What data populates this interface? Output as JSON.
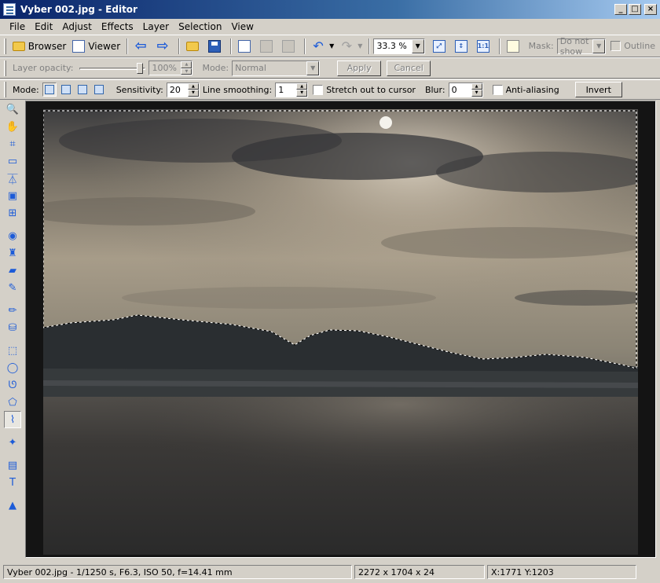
{
  "window": {
    "title": "Vyber 002.jpg - Editor"
  },
  "menu": [
    "File",
    "Edit",
    "Adjust",
    "Effects",
    "Layer",
    "Selection",
    "View"
  ],
  "toolbar1": {
    "browser_label": "Browser",
    "viewer_label": "Viewer",
    "zoom_value": "33.3 %",
    "mask_label": "Mask:",
    "mask_value": "Do not show",
    "outline_label": "Outline"
  },
  "toolbar2": {
    "opacity_label": "Layer opacity:",
    "opacity_value": "100%",
    "mode_label": "Mode:",
    "mode_value": "Normal",
    "apply_label": "Apply",
    "cancel_label": "Cancel"
  },
  "toolbar3": {
    "mode_label": "Mode:",
    "sensitivity_label": "Sensitivity:",
    "sensitivity_value": "20",
    "smoothing_label": "Line smoothing:",
    "smoothing_value": "1",
    "stretch_label": "Stretch out to cursor",
    "blur_label": "Blur:",
    "blur_value": "0",
    "antialias_label": "Anti-aliasing",
    "invert_label": "Invert"
  },
  "status": {
    "file_info": "Vyber 002.jpg - 1/1250 s, F6.3, ISO 50, f=14.41 mm",
    "dimensions": "2272 x 1704 x 24",
    "coords": "X:1771  Y:1203"
  },
  "tools": [
    "zoom-icon",
    "hand-icon",
    "crop-icon",
    "resize-icon",
    "perspective-icon",
    "frame-icon",
    "transform-icon",
    "red-eye-icon",
    "clone-stamp-icon",
    "eraser-icon",
    "brush-icon",
    "pencil-icon",
    "paint-bucket-icon",
    "rect-select-icon",
    "ellipse-select-icon",
    "lasso-icon",
    "polygon-lasso-icon",
    "magnetic-lasso-icon",
    "magic-wand-icon",
    "layer-icon",
    "text-icon",
    "navigator-icon"
  ]
}
